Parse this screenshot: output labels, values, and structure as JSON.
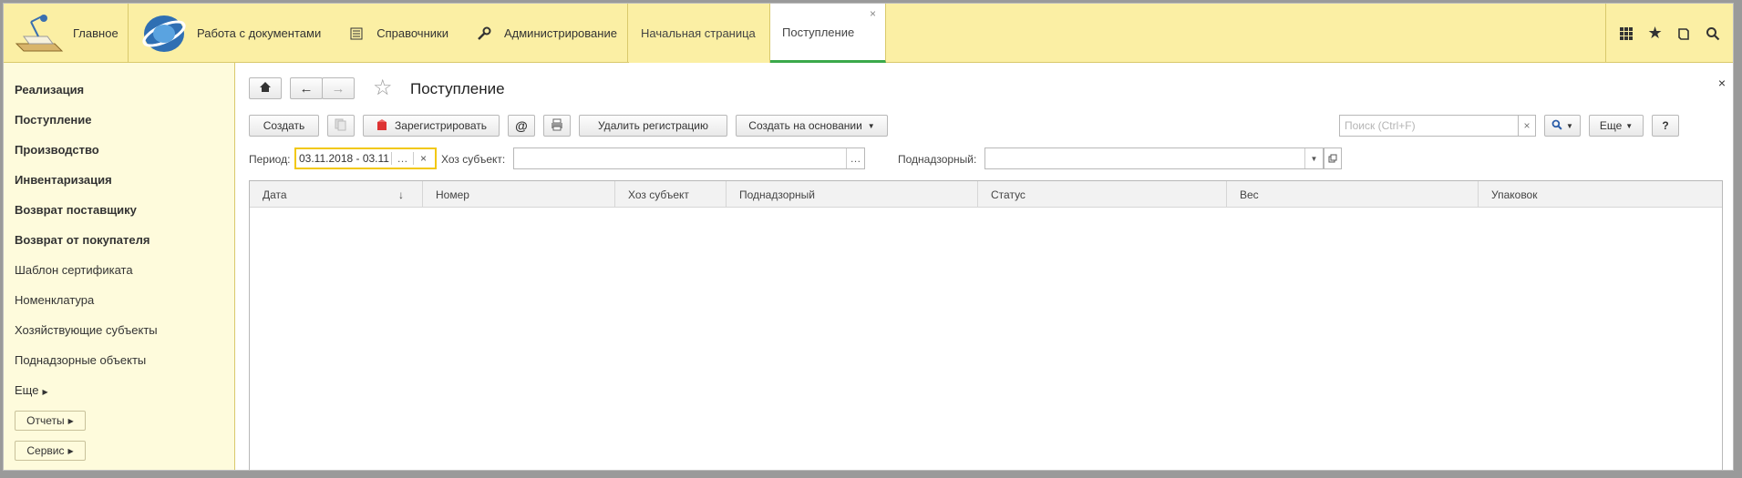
{
  "topbar": {
    "home_label": "Главное",
    "nav": [
      {
        "label": "Работа с документами",
        "icon": "globe-logo"
      },
      {
        "label": "Справочники",
        "icon": "list-icon"
      },
      {
        "label": "Администрирование",
        "icon": "wrench-icon"
      }
    ],
    "tabs": [
      {
        "label": "Начальная страница"
      },
      {
        "label": "Поступление",
        "close": "×"
      }
    ],
    "right_icons": [
      "apps-grid-icon",
      "star-icon",
      "history-icon",
      "search-icon"
    ]
  },
  "sidebar": {
    "items": [
      {
        "label": "Реализация",
        "bold": true
      },
      {
        "label": "Поступление",
        "bold": true
      },
      {
        "label": "Производство",
        "bold": true
      },
      {
        "label": "Инвентаризация",
        "bold": true
      },
      {
        "label": "Возврат поставщику",
        "bold": true
      },
      {
        "label": "Возврат от покупателя",
        "bold": true
      },
      {
        "label": "Шаблон сертификата",
        "bold": false
      },
      {
        "label": "Номенклатура",
        "bold": false
      },
      {
        "label": "Хозяйствующие субъекты",
        "bold": false
      },
      {
        "label": "Поднадзорные объекты",
        "bold": false
      },
      {
        "label": "Еще",
        "bold": false
      }
    ],
    "reports_label": "Отчеты",
    "service_label": "Сервис"
  },
  "main": {
    "title": "Поступление",
    "close": "×",
    "toolbar": {
      "create": "Создать",
      "register": "Зарегистрировать",
      "at": "@",
      "delete_registration": "Удалить регистрацию",
      "create_based_on": "Создать на основании",
      "search_placeholder": "Поиск (Ctrl+F)",
      "more": "Еще",
      "help": "?"
    },
    "filters": {
      "period_label": "Период:",
      "period_value": "03.11.2018 - 03.11",
      "subject_label": "Хоз субъект:",
      "subject_value": "",
      "supervised_label": "Поднадзорный:",
      "supervised_value": ""
    },
    "grid": {
      "columns": [
        "Дата",
        "Номер",
        "Хоз субъект",
        "Поднадзорный",
        "Статус",
        "Вес",
        "Упаковок"
      ],
      "sort_indicator": "↓"
    }
  },
  "colors": {
    "topbar_bg": "#fbefa4",
    "sidebar_bg": "#fefbdc",
    "active_tab_underline": "#3aa94a",
    "period_focus_border": "#f2c811"
  }
}
